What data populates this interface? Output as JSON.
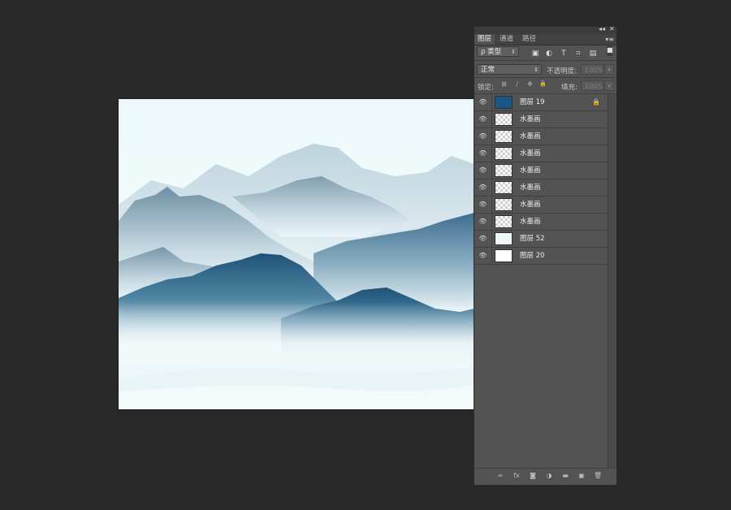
{
  "window": {
    "collapse_glyph": "◂◂",
    "close_glyph": "✕"
  },
  "tabs": [
    {
      "label": "图层",
      "active": true
    },
    {
      "label": "通道",
      "active": false
    },
    {
      "label": "路径",
      "active": false
    }
  ],
  "panel_menu_glyph": "▾≡",
  "filter": {
    "search_glyph": "ρ",
    "kind_label": "类型",
    "toggle_glyph": "■",
    "icons": [
      "image-filter-icon",
      "adjustment-filter-icon",
      "type-filter-icon",
      "shape-filter-icon",
      "smart-object-filter-icon"
    ],
    "icon_glyphs": [
      "▣",
      "◐",
      "T",
      "⌗",
      "▤"
    ]
  },
  "blend": {
    "mode": "正常",
    "opacity_label": "不透明度:",
    "opacity_value": "100%"
  },
  "lock": {
    "label": "锁定:",
    "fill_label": "填充:",
    "fill_value": "100%",
    "icons": [
      "lock-transparent-icon",
      "lock-paint-icon",
      "lock-position-icon",
      "lock-all-icon"
    ],
    "icon_glyphs": [
      "⊠",
      "∕",
      "✥",
      "🔒"
    ]
  },
  "layers": [
    {
      "name": "图层 19",
      "thumb": "blue",
      "color": "#1a5784",
      "locked": true
    },
    {
      "name": "水墨画",
      "thumb": "transparent"
    },
    {
      "name": "水墨画",
      "thumb": "transparent"
    },
    {
      "name": "水墨画",
      "thumb": "transparent"
    },
    {
      "name": "水墨画",
      "thumb": "transparent"
    },
    {
      "name": "水墨画",
      "thumb": "transparent"
    },
    {
      "name": "水墨画",
      "thumb": "transparent"
    },
    {
      "name": "水墨画",
      "thumb": "transparent"
    },
    {
      "name": "图层 52",
      "thumb": "white",
      "color": "#eef7fa"
    },
    {
      "name": "图层 20",
      "thumb": "white",
      "color": "#ffffff"
    }
  ],
  "eye_glyph": "👁",
  "lock_glyph": "🔒",
  "bottom_icons": [
    {
      "name": "link-layers-icon",
      "glyph": "∞"
    },
    {
      "name": "fx-icon",
      "glyph": "fx"
    },
    {
      "name": "add-mask-icon",
      "glyph": "◙"
    },
    {
      "name": "adjustment-layer-icon",
      "glyph": "◑"
    },
    {
      "name": "new-group-icon",
      "glyph": "▬"
    },
    {
      "name": "new-layer-icon",
      "glyph": "▣"
    },
    {
      "name": "delete-layer-icon",
      "glyph": "🗑"
    }
  ],
  "colors": {
    "accent_layer": "#1a5784",
    "panel_bg": "#535353",
    "app_bg": "#282828"
  }
}
